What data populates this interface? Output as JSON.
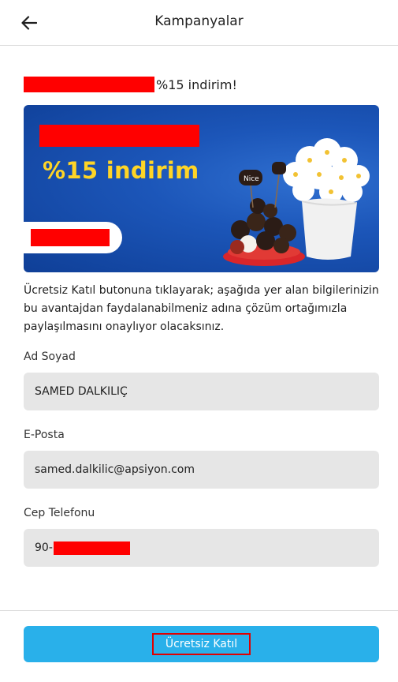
{
  "header": {
    "title": "Kampanyalar",
    "back_icon": "arrow-left-icon"
  },
  "promo": {
    "title_suffix": "%15 indirim!"
  },
  "banner": {
    "headline": "%15 indirim",
    "headline_color": "#ffd526",
    "background_color": "#1c56b9",
    "art_label": "Nice"
  },
  "info": {
    "text": "Ücretsiz Katıl butonuna tıklayarak; aşağıda yer alan bilgilerinizin bu avantajdan faydalanabilmeniz adına çözüm ortağımızla paylaşılmasını onaylıyor olacaksınız."
  },
  "form": {
    "name_label": "Ad Soyad",
    "name_value": "SAMED DALKILIÇ",
    "email_label": "E-Posta",
    "email_value": "samed.dalkilic@apsiyon.com",
    "phone_label": "Cep Telefonu",
    "phone_prefix": "90-"
  },
  "actions": {
    "join_label": "Ücretsiz Katıl",
    "join_color": "#29b0ea"
  }
}
